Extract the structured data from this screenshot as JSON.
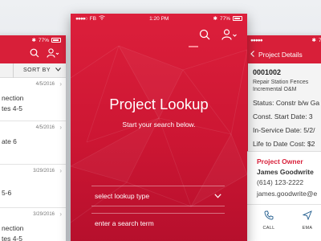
{
  "status_bar": {
    "carrier": "FB",
    "time": "1:20 PM",
    "battery": "77%"
  },
  "left_screen": {
    "sort_label": "SORT BY",
    "items": [
      {
        "date": "4/5/2016",
        "line1": "nection",
        "line2": "tes 4-5"
      },
      {
        "date": "4/5/2016",
        "line1": "ate 6",
        "line2": ""
      },
      {
        "date": "3/29/2016",
        "line1": "5-6",
        "line2": ""
      },
      {
        "date": "3/29/2016",
        "line1": "nection",
        "line2": "tes 4-5"
      }
    ]
  },
  "center_screen": {
    "title": "Project Lookup",
    "subtitle": "Start your search below.",
    "select_placeholder": "select lookup type",
    "search_placeholder": "enter a search term"
  },
  "right_screen": {
    "header_title": "Project Details",
    "back_label": "<",
    "project_number": "0001002",
    "description_line1": "Repair Station Fences",
    "description_line2": "Incremental O&M",
    "status": "Status: Constr b/w Ga",
    "const_start": "Const. Start Date: 3",
    "in_service": "In-Service Date: 5/2/",
    "life_to_date": "Life to Date Cost: $2",
    "owner": {
      "heading": "Project Owner",
      "name": "James Goodwrite",
      "phone": "(614) 123-2222",
      "email": "james.goodwrite@e"
    },
    "actions": {
      "call": "CALL",
      "email": "EMA"
    }
  },
  "colors": {
    "brand_red": "#d81f39",
    "accent_pink": "#ff8a96"
  },
  "icons": [
    "search-icon",
    "user-icon",
    "chevron-down-icon",
    "chevron-right-icon",
    "back-chevron-icon",
    "phone-icon",
    "send-icon",
    "wifi-icon",
    "battery-icon",
    "bluetooth-icon"
  ]
}
